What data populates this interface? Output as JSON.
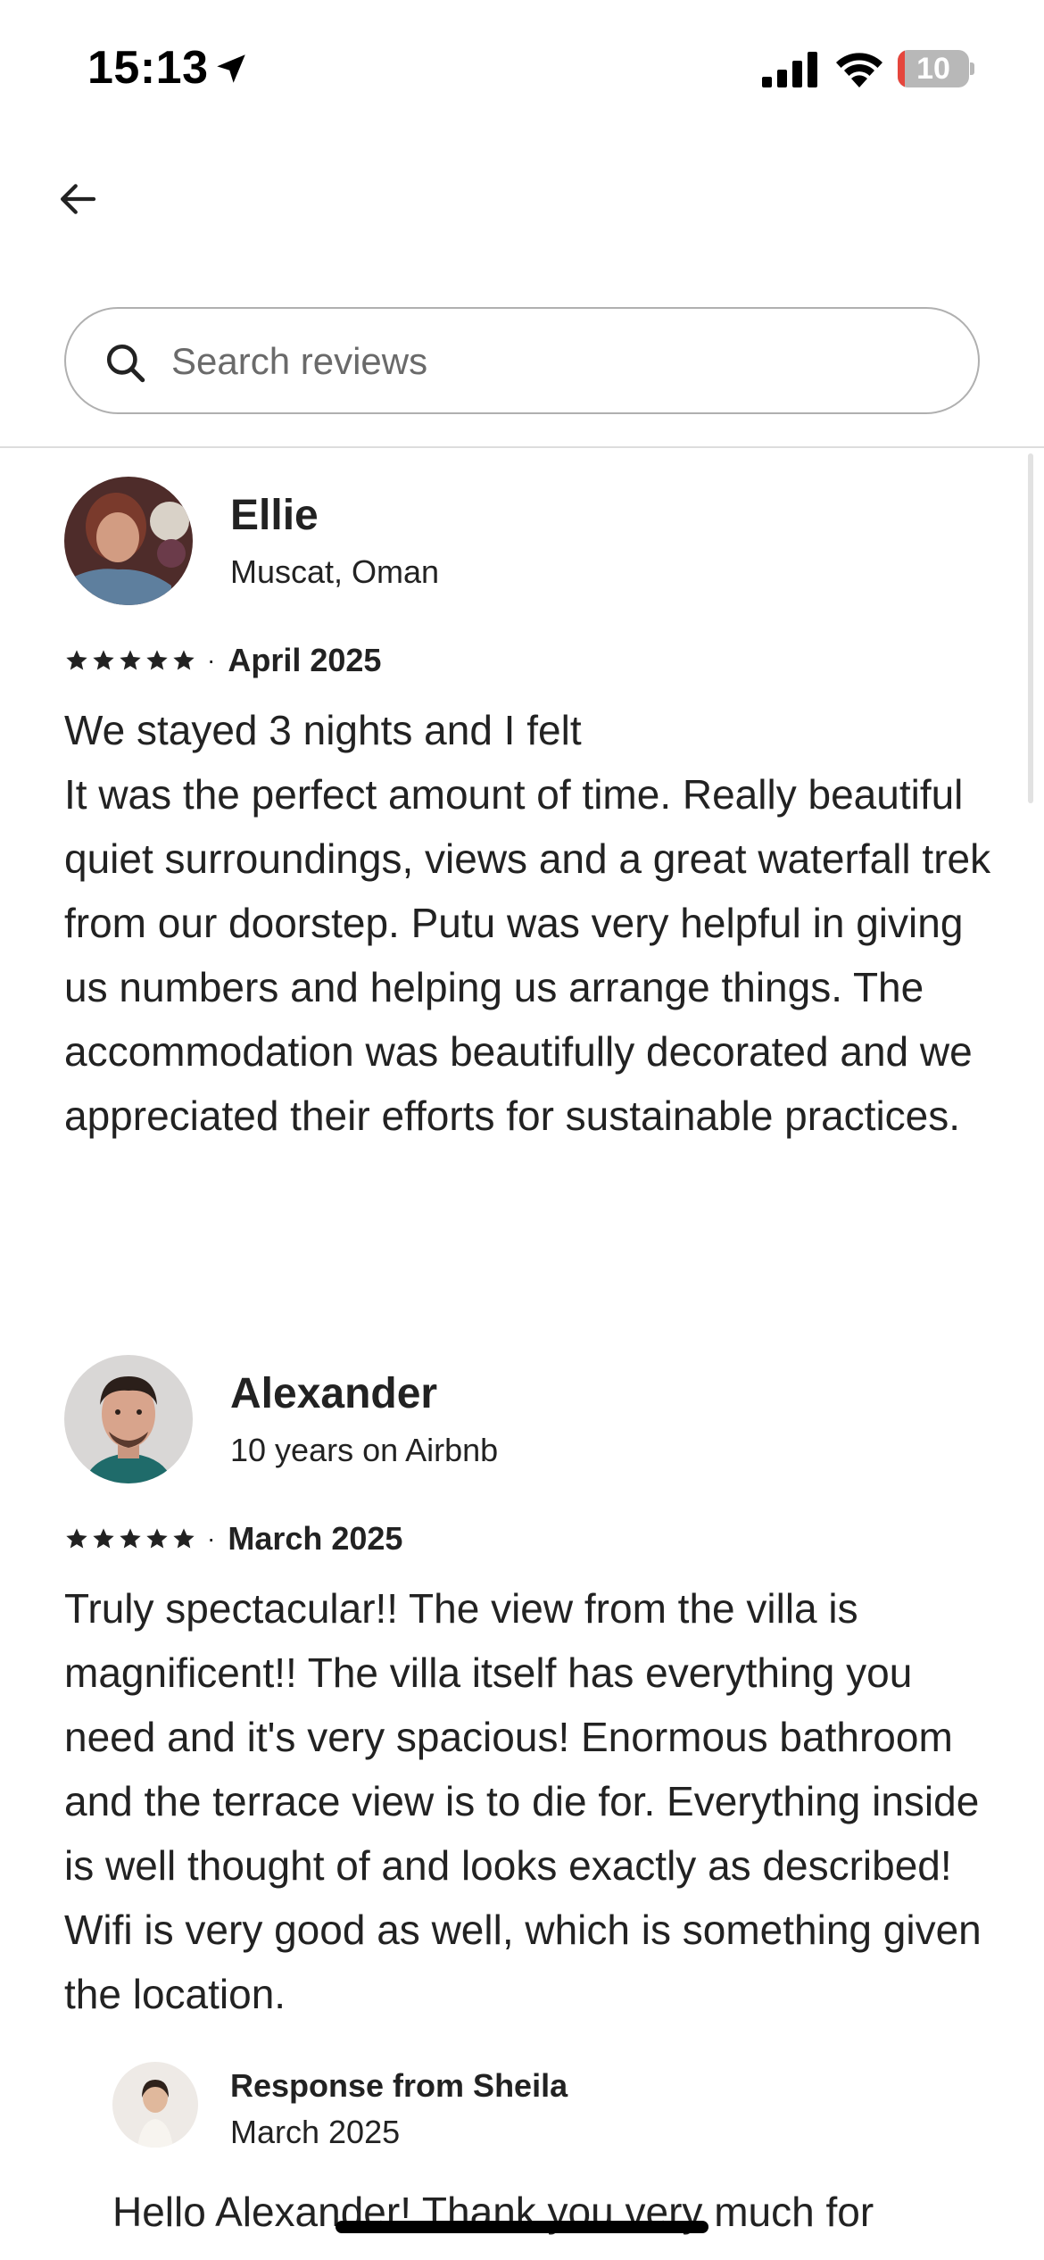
{
  "status_bar": {
    "time": "15:13",
    "battery_level": "10",
    "battery_fraction": 0.1,
    "icons": [
      "location-arrow-icon",
      "cellular-signal-icon",
      "wifi-icon",
      "battery-icon"
    ]
  },
  "nav": {
    "back_icon": "arrow-left-icon"
  },
  "search": {
    "placeholder": "Search reviews",
    "value": "",
    "icon": "search-icon"
  },
  "reviews": [
    {
      "name": "Ellie",
      "subtitle": "Muscat, Oman",
      "rating": 5,
      "separator": "·",
      "date": "April 2025",
      "text": "We stayed 3 nights and I felt\nIt was the perfect amount of time. Really beautiful quiet surroundings, views and a great waterfall trek from our doorstep. Putu was very helpful in giving us numbers and helping us arrange things. The accommodation was beautifully decorated and we appreciated their efforts for sustainable practices."
    },
    {
      "name": "Alexander",
      "subtitle": "10 years on Airbnb",
      "rating": 5,
      "separator": "·",
      "date": "March 2025",
      "text": "Truly spectacular!! The view from the villa is magnificent!! The villa itself has everything you need and it's very spacious! Enormous bathroom and the terrace view is to die for. Everything inside is well thought of and looks exactly as described!  Wifi is very good as well, which is something given the location.",
      "response": {
        "title": "Response from Sheila",
        "date": "March 2025",
        "text": "Hello Alexander! Thank you very much for"
      }
    }
  ],
  "colors": {
    "text": "#222222",
    "muted": "#6a6a6a",
    "border": "#b0b0b0",
    "divider": "#dddddd",
    "battery_low": "#e5463d"
  }
}
